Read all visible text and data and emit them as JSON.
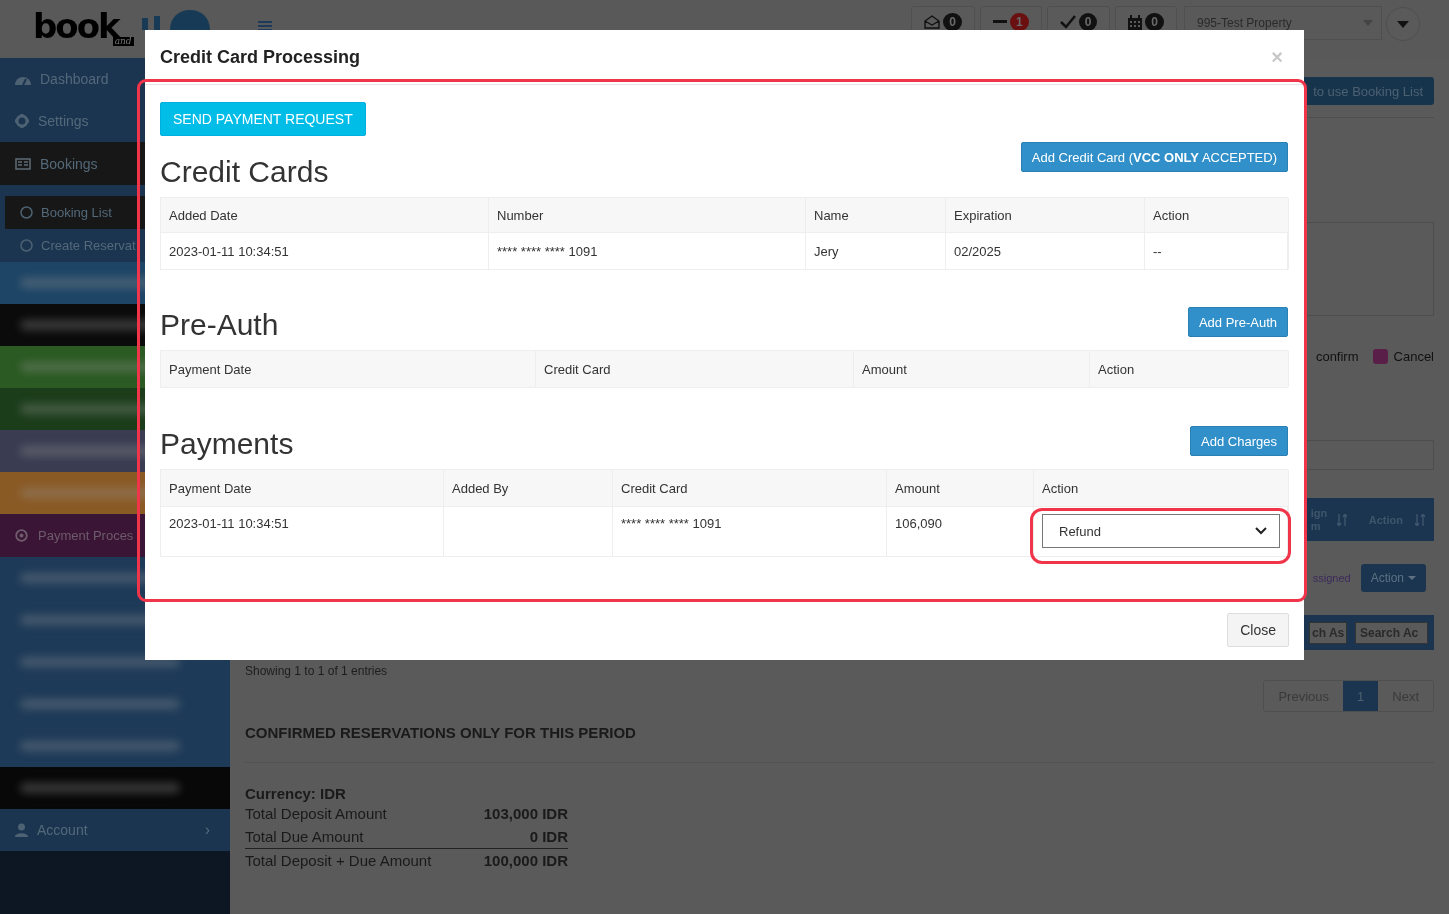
{
  "header": {
    "logo": {
      "word_1": "book",
      "tagline": "and"
    },
    "badges": [
      {
        "kind": "mail",
        "count": "0",
        "color": "#111111"
      },
      {
        "kind": "minus",
        "count": "1",
        "color": "#6b1010"
      },
      {
        "kind": "check",
        "count": "0",
        "color": "#111111"
      },
      {
        "kind": "calendar",
        "count": "0",
        "color": "#111111"
      }
    ],
    "property_select": {
      "value": "995-Test Property"
    }
  },
  "sidebar": {
    "items": [
      {
        "kind": "dashboard",
        "label": "Dashboard",
        "selected": false
      },
      {
        "kind": "settings",
        "label": "Settings",
        "selected": false
      },
      {
        "kind": "bookings",
        "label": "Bookings",
        "selected": true
      },
      {
        "kind": "sub",
        "label": "Booking List",
        "selected": true
      },
      {
        "kind": "sub",
        "label": "Create Reservat",
        "selected": false
      },
      {
        "kind": "blurred",
        "color": "#1e4566"
      },
      {
        "kind": "blurred",
        "color": "#0b0b0b"
      },
      {
        "kind": "blurred",
        "color": "#2b5a22"
      },
      {
        "kind": "blurred",
        "color": "#1b3d1a"
      },
      {
        "kind": "blurred",
        "color": "#3a3d52"
      },
      {
        "kind": "blurred",
        "color": "#8a5a25"
      },
      {
        "kind": "band",
        "label": "Payment Proces",
        "color": "#3a1536"
      },
      {
        "kind": "blurred",
        "color": "#1d3a58"
      },
      {
        "kind": "blurred",
        "color": "#1d3a58"
      },
      {
        "kind": "blurred",
        "color": "#1d3a58"
      },
      {
        "kind": "blurred",
        "color": "#1d3a58"
      },
      {
        "kind": "blurred",
        "color": "#1d3a58"
      },
      {
        "kind": "blurred",
        "color": "#080808"
      },
      {
        "kind": "account",
        "label": "Account",
        "selected": false,
        "chevron": "›"
      }
    ]
  },
  "page": {
    "help_button": "to use Booking List",
    "legend": [
      {
        "label": "confirm"
      },
      {
        "label": "Cancel",
        "color": "#5a1f48"
      }
    ],
    "table_header": {
      "column_1": "ign m",
      "column_2": "Action"
    },
    "row": {
      "status": "ssigned",
      "action_button": "Action"
    },
    "search_fields": [
      {
        "value": "ch As"
      },
      {
        "value": "Search Ac"
      }
    ],
    "info": "Showing 1 to 1 of 1 entries",
    "pagination": [
      {
        "label": "Previous",
        "selected": false
      },
      {
        "label": "1",
        "selected": true
      },
      {
        "label": "Next",
        "selected": false
      }
    ],
    "summary_title": "CONFIRMED RESERVATIONS ONLY FOR THIS PERIOD",
    "currency": "Currency: IDR",
    "totals": [
      {
        "label": "Total Deposit Amount",
        "value": "103,000 IDR"
      },
      {
        "label": "Total Due Amount",
        "value": "0 IDR"
      },
      {
        "label": "Total Deposit + Due Amount",
        "value": "100,000 IDR"
      }
    ]
  },
  "modal": {
    "title": "Credit Card Processing",
    "close": "×",
    "send_button": "SEND PAYMENT REQUEST",
    "credit_cards": {
      "title": "Credit Cards",
      "button": "Add Credit Card (**VCC ONLY** ACCEPTED)",
      "columns": [
        "Added Date",
        "Number",
        "Name",
        "Expiration",
        "Action"
      ],
      "rows": [
        [
          "2023-01-11 10:34:51",
          "**** **** **** 1091",
          "Jery",
          "02/2025",
          "--"
        ]
      ]
    },
    "pre_auth": {
      "title": "Pre-Auth",
      "button": "Add Pre-Auth",
      "columns": [
        "Payment Date",
        "Credit Card",
        "Amount",
        "Action"
      ]
    },
    "payments": {
      "title": "Payments",
      "button": "Add Charges",
      "columns": [
        "Payment Date",
        "Added By",
        "Credit Card",
        "Amount",
        "Action"
      ],
      "rows": [
        {
          "payment_date": "2023-01-11 10:34:51",
          "credit_card": "**** **** **** 1091",
          "amount": "106,090",
          "action": "Refund"
        }
      ]
    },
    "footer_button": "Close"
  }
}
